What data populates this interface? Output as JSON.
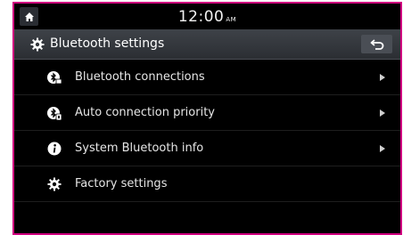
{
  "status": {
    "time": "12:00",
    "ampm": "AM"
  },
  "titlebar": {
    "title": "Bluetooth settings"
  },
  "menu": {
    "items": [
      {
        "label": "Bluetooth connections",
        "icon": "bluetooth-connections-icon"
      },
      {
        "label": "Auto connection priority",
        "icon": "auto-connection-icon"
      },
      {
        "label": "System Bluetooth info",
        "icon": "info-icon"
      },
      {
        "label": "Factory settings",
        "icon": "gear-icon"
      }
    ]
  },
  "colors": {
    "frame": "#d0007f",
    "background": "#000000",
    "titlebar": "#3e4248"
  }
}
